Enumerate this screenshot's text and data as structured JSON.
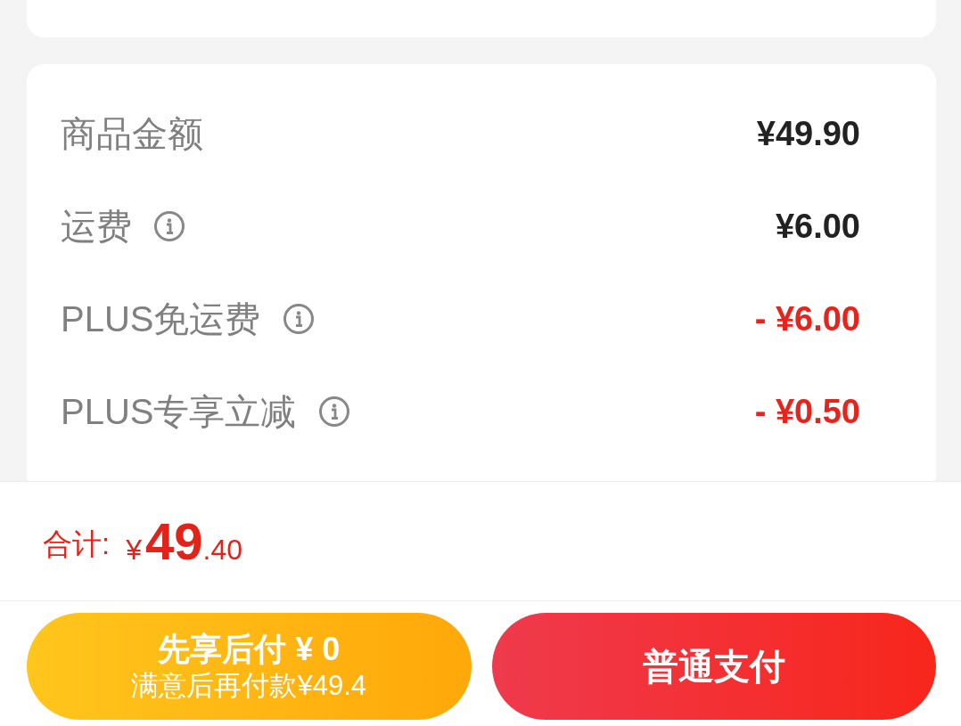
{
  "price_details": {
    "rows": [
      {
        "kind": "amount",
        "label": "商品金额",
        "info": false,
        "value": "¥49.90"
      },
      {
        "kind": "amount",
        "label": "运费",
        "info": true,
        "value": "¥6.00"
      },
      {
        "kind": "discount",
        "label": "PLUS免运费",
        "info": true,
        "value": "- ¥6.00"
      },
      {
        "kind": "discount",
        "label": "PLUS专享立减",
        "info": true,
        "value": "- ¥0.50"
      }
    ]
  },
  "total": {
    "label": "合计:",
    "amount": {
      "currency": "¥",
      "integer": "49",
      "decimal": ".40"
    }
  },
  "buttons": [
    {
      "kind": "installment",
      "title": "先享后付 ¥ 0",
      "subtitle": "满意后再付款¥49.4"
    },
    {
      "kind": "standard",
      "title": "普通支付"
    }
  ]
}
